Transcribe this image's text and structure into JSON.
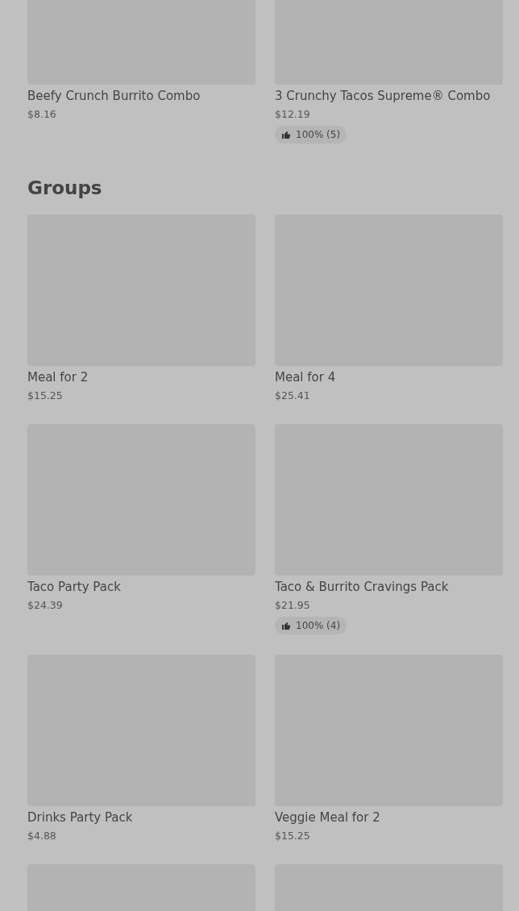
{
  "top_items": [
    {
      "kind": "item",
      "name": "Beefy Crunch Burrito Combo",
      "price": "$8.16"
    },
    {
      "kind": "item",
      "name": "3 Crunchy Tacos Supreme® Combo",
      "price": "$12.19",
      "rating": "100% (5)"
    }
  ],
  "groups": {
    "title": "Groups",
    "items": [
      {
        "kind": "item",
        "name": "Meal for 2",
        "price": "$15.25"
      },
      {
        "kind": "item",
        "name": "Meal for 4",
        "price": "$25.41"
      },
      {
        "kind": "item",
        "name": "Taco Party Pack",
        "price": "$24.39"
      },
      {
        "kind": "item",
        "name": "Taco & Burrito Cravings Pack",
        "price": "$21.95",
        "rating": "100% (4)"
      },
      {
        "kind": "item",
        "name": "Drinks Party Pack",
        "price": "$4.88"
      },
      {
        "kind": "item",
        "name": "Veggie Meal for 2",
        "price": "$15.25"
      },
      {
        "kind": "image_only"
      },
      {
        "kind": "image_only"
      }
    ]
  }
}
